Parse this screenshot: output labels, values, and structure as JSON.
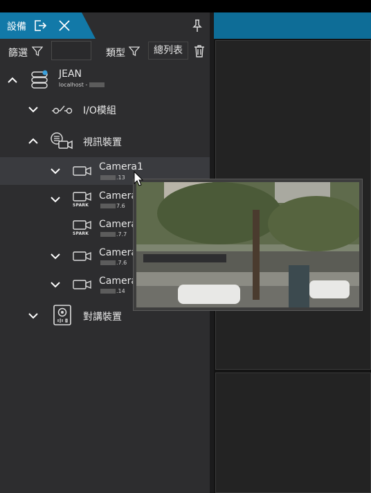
{
  "panel": {
    "tab_title": "設備",
    "tab_icons": [
      "logout-icon",
      "close-icon"
    ],
    "pin_icon": "pin-icon"
  },
  "filter": {
    "filter_label": "篩選",
    "filter_value": "",
    "type_label": "類型",
    "summary_button": "總列表",
    "trash_icon": "trash-icon"
  },
  "tree": {
    "server": {
      "name": "JEAN",
      "host": "localhost -"
    },
    "io": {
      "name": "I/O模組"
    },
    "video": {
      "name": "視訊裝置"
    },
    "cameras": [
      {
        "name": "Camera1",
        "ip_suffix": ".13",
        "spark": false
      },
      {
        "name": "Camera",
        "ip_suffix": "7.6",
        "spark": true
      },
      {
        "name": "Camera",
        "ip_suffix": ".7.7",
        "spark": true
      },
      {
        "name": "Camera",
        "ip_suffix": ".7.6",
        "spark": false
      },
      {
        "name": "Camera",
        "ip_suffix": ".14",
        "spark": false
      }
    ],
    "spark_label": "SPARK",
    "intercom": {
      "name": "對講裝置"
    }
  },
  "colors": {
    "accent": "#1279a8",
    "panel": "#2d2d2f",
    "highlight": "#3a3b3f"
  }
}
